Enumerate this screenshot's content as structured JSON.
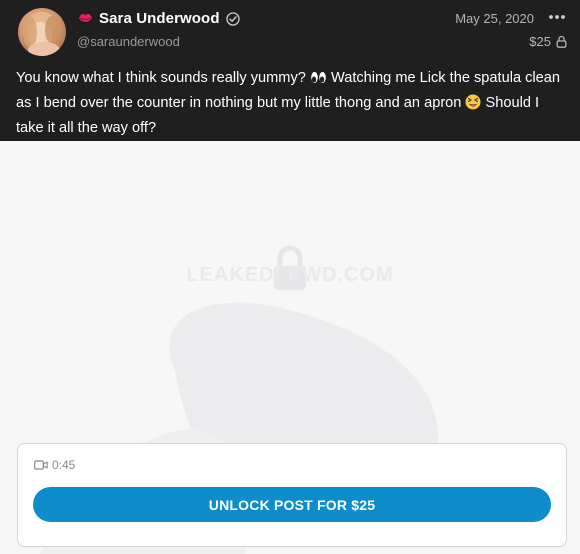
{
  "author": {
    "name": "Sara Underwood",
    "handle": "@saraunderwood",
    "verified": true
  },
  "post": {
    "date": "May 25, 2020",
    "price": "$25",
    "text_part1": "You know what I think sounds really yummy? ",
    "text_part2": " Watching me Lick the spatula clean as I bend over the counter in nothing but my little thong and an apron ",
    "text_part3": " Should I take it all the way off?"
  },
  "media": {
    "watermark": "LEAKEDLEWD.COM",
    "duration": "0:45",
    "unlock_label": "UNLOCK POST FOR $25"
  },
  "icons": {
    "lips": "lips-emoji-icon",
    "verified": "verified-badge-icon",
    "more": "more-dots-icon",
    "lock": "lock-icon",
    "eyes": "eyes-emoji-icon",
    "tongue": "squinting-tongue-emoji-icon",
    "video": "video-camera-icon"
  },
  "colors": {
    "header_bg": "#1f1f1f",
    "media_bg": "#f7f7f8",
    "accent": "#0f8dcb",
    "lips": "#e0245e"
  }
}
